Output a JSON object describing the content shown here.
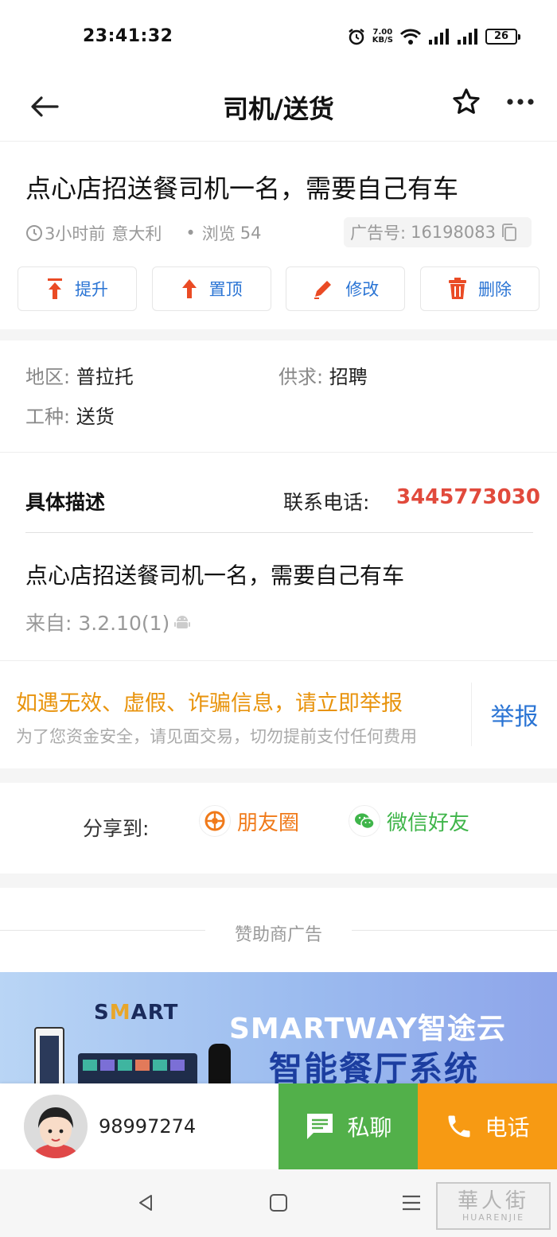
{
  "status_bar": {
    "time": "23:41:32",
    "speed_value": "7.00",
    "speed_unit": "KB/S",
    "battery": "26"
  },
  "header": {
    "title": "司机/送货"
  },
  "post": {
    "title": "点心店招送餐司机一名，需要自己有车",
    "time_ago": "3小时前",
    "location": "意大利",
    "views_label": "浏览",
    "views": "54",
    "ad_id_label": "广告号:",
    "ad_id": "16198083"
  },
  "actions": [
    {
      "label": "提升"
    },
    {
      "label": "置顶"
    },
    {
      "label": "修改"
    },
    {
      "label": "删除"
    }
  ],
  "info": {
    "region_label": "地区:",
    "region": "普拉托",
    "supply_label": "供求:",
    "supply": "招聘",
    "job_label": "工种:",
    "job": "送货"
  },
  "description": {
    "heading": "具体描述",
    "phone_label": "联系电话:",
    "phone": "3445773030",
    "body": "点心店招送餐司机一名，需要自己有车",
    "source": "来自: 3.2.10(1)"
  },
  "warning": {
    "title": "如遇无效、虚假、诈骗信息，请立即举报",
    "subtitle": "为了您资金安全，请见面交易，切勿提前支付任何费用",
    "report": "举报"
  },
  "share": {
    "label": "分享到:",
    "moments": "朋友圈",
    "wechat": "微信好友",
    "moments_color": "#f07a1a",
    "wechat_color": "#3fb54a"
  },
  "sponsor": {
    "label": "赞助商广告",
    "ad_logo_pre": "S",
    "ad_logo_m": "M",
    "ad_logo_post": "ART",
    "ad_brand": "SMARTWAY智途云",
    "ad_slogan": "智能餐厅系统"
  },
  "bottom": {
    "user_id": "98997274",
    "chat": "私聊",
    "call": "电话"
  },
  "watermark": {
    "cn": "華人街",
    "en": "HUARENJIE"
  },
  "colors": {
    "accent_blue": "#2a74d4",
    "phone_red": "#e14a3c",
    "warning_orange": "#e8930c",
    "chat_green": "#52b04a",
    "call_orange": "#f79a13"
  }
}
